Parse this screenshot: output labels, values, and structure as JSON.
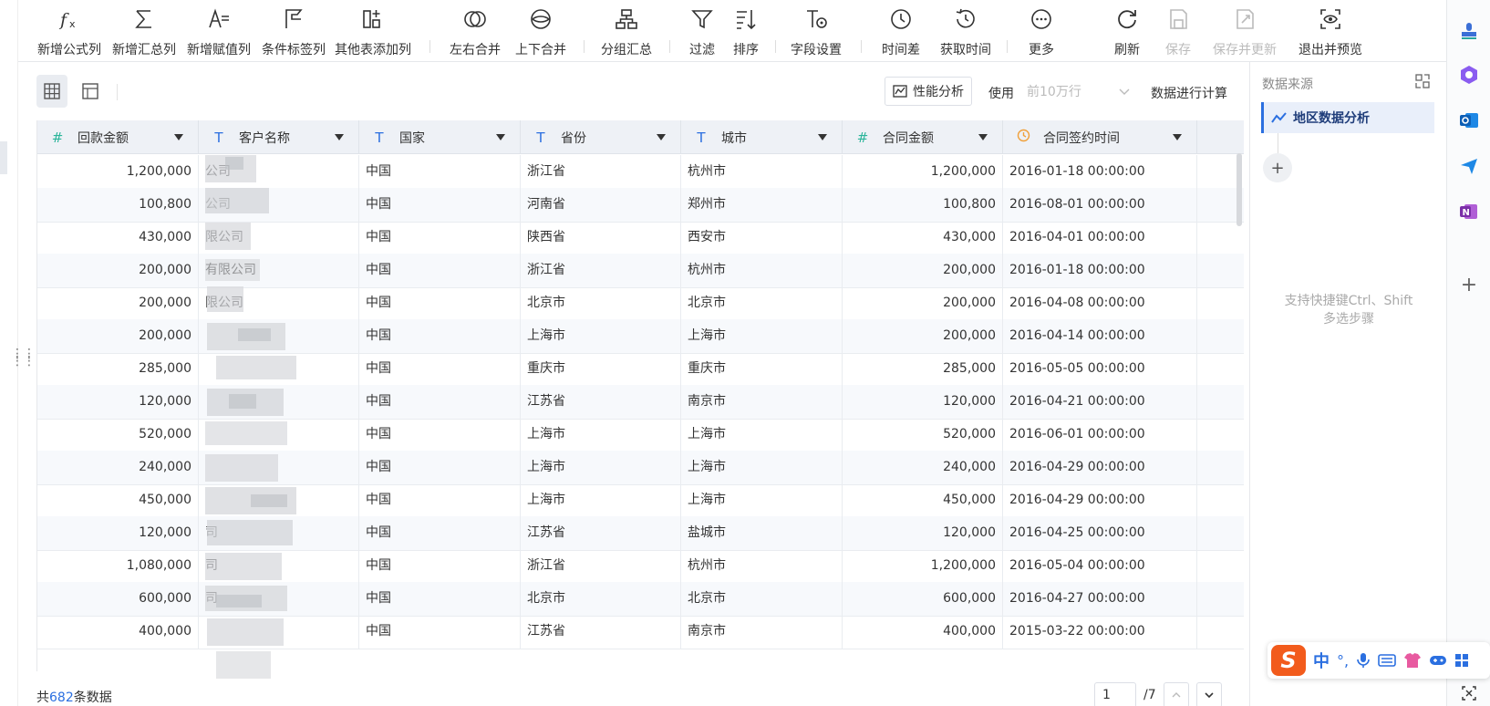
{
  "toolbar": {
    "items": [
      {
        "label": "新增公式列",
        "icon": "formula-icon"
      },
      {
        "label": "新增汇总列",
        "icon": "sigma-icon"
      },
      {
        "label": "新增赋值列",
        "icon": "assign-column-icon"
      },
      {
        "label": "条件标签列",
        "icon": "flag-icon"
      },
      {
        "label": "其他表添加列",
        "icon": "add-column-icon"
      },
      {
        "label": "左右合并",
        "icon": "horizontal-merge-icon"
      },
      {
        "label": "上下合并",
        "icon": "vertical-merge-icon"
      },
      {
        "label": "分组汇总",
        "icon": "group-summary-icon"
      },
      {
        "label": "过滤",
        "icon": "filter-icon"
      },
      {
        "label": "排序",
        "icon": "sort-icon"
      },
      {
        "label": "字段设置",
        "icon": "field-settings-icon"
      },
      {
        "label": "时间差",
        "icon": "time-diff-icon"
      },
      {
        "label": "获取时间",
        "icon": "get-time-icon"
      },
      {
        "label": "更多",
        "icon": "more-icon"
      },
      {
        "label": "刷新",
        "icon": "refresh-icon"
      },
      {
        "label": "保存",
        "icon": "save-icon"
      },
      {
        "label": "保存并更新",
        "icon": "save-update-icon"
      },
      {
        "label": "退出并预览",
        "icon": "exit-preview-icon"
      }
    ]
  },
  "viewbar": {
    "perf_label": "性能分析",
    "use_label": "使用",
    "row_limit": "前10万行",
    "calc_label": "数据进行计算"
  },
  "table": {
    "columns": [
      {
        "name": "回款金额",
        "type": "#"
      },
      {
        "name": "客户名称",
        "type": "T"
      },
      {
        "name": "国家",
        "type": "T"
      },
      {
        "name": "省份",
        "type": "T"
      },
      {
        "name": "城市",
        "type": "T"
      },
      {
        "name": "合同金额",
        "type": "#"
      },
      {
        "name": "合同签约时间",
        "type": "clock"
      }
    ],
    "rows": [
      [
        "1,200,000",
        "公司",
        "中国",
        "浙江省",
        "杭州市",
        "1,200,000",
        "2016-01-18 00:00:00"
      ],
      [
        "100,800",
        "公司",
        "中国",
        "河南省",
        "郑州市",
        "100,800",
        "2016-08-01 00:00:00"
      ],
      [
        "430,000",
        "限公司",
        "中国",
        "陕西省",
        "西安市",
        "430,000",
        "2016-04-01 00:00:00"
      ],
      [
        "200,000",
        "有限公司",
        "中国",
        "浙江省",
        "杭州市",
        "200,000",
        "2016-01-18 00:00:00"
      ],
      [
        "200,000",
        "限公司",
        "中国",
        "北京市",
        "北京市",
        "200,000",
        "2016-04-08 00:00:00"
      ],
      [
        "200,000",
        "",
        "中国",
        "上海市",
        "上海市",
        "200,000",
        "2016-04-14 00:00:00"
      ],
      [
        "285,000",
        "",
        "中国",
        "重庆市",
        "重庆市",
        "285,000",
        "2016-05-05 00:00:00"
      ],
      [
        "120,000",
        "",
        "中国",
        "江苏省",
        "南京市",
        "120,000",
        "2016-04-21 00:00:00"
      ],
      [
        "520,000",
        "",
        "中国",
        "上海市",
        "上海市",
        "520,000",
        "2016-06-01 00:00:00"
      ],
      [
        "240,000",
        "",
        "中国",
        "上海市",
        "上海市",
        "240,000",
        "2016-04-29 00:00:00"
      ],
      [
        "450,000",
        "",
        "中国",
        "上海市",
        "上海市",
        "450,000",
        "2016-04-29 00:00:00"
      ],
      [
        "120,000",
        "司",
        "中国",
        "江苏省",
        "盐城市",
        "120,000",
        "2016-04-25 00:00:00"
      ],
      [
        "1,080,000",
        "司",
        "中国",
        "浙江省",
        "杭州市",
        "1,200,000",
        "2016-05-04 00:00:00"
      ],
      [
        "600,000",
        "司",
        "中国",
        "北京市",
        "北京市",
        "600,000",
        "2016-04-27 00:00:00"
      ],
      [
        "400,000",
        "",
        "中国",
        "江苏省",
        "南京市",
        "400,000",
        "2015-03-22 00:00:00"
      ]
    ]
  },
  "footer": {
    "prefix": "共",
    "count": "682",
    "suffix": "条数据",
    "page": "1",
    "total_pages": "/7"
  },
  "right_panel": {
    "title": "数据来源",
    "source_name": "地区数据分析",
    "hint_line1": "支持快捷键Ctrl、Shift",
    "hint_line2": "多选步骤"
  },
  "ime": {
    "logo": "S",
    "mode": "中"
  },
  "colors": {
    "accent": "#2b6fe0",
    "number_type": "#2bb59a",
    "time_type": "#f0a03a"
  }
}
